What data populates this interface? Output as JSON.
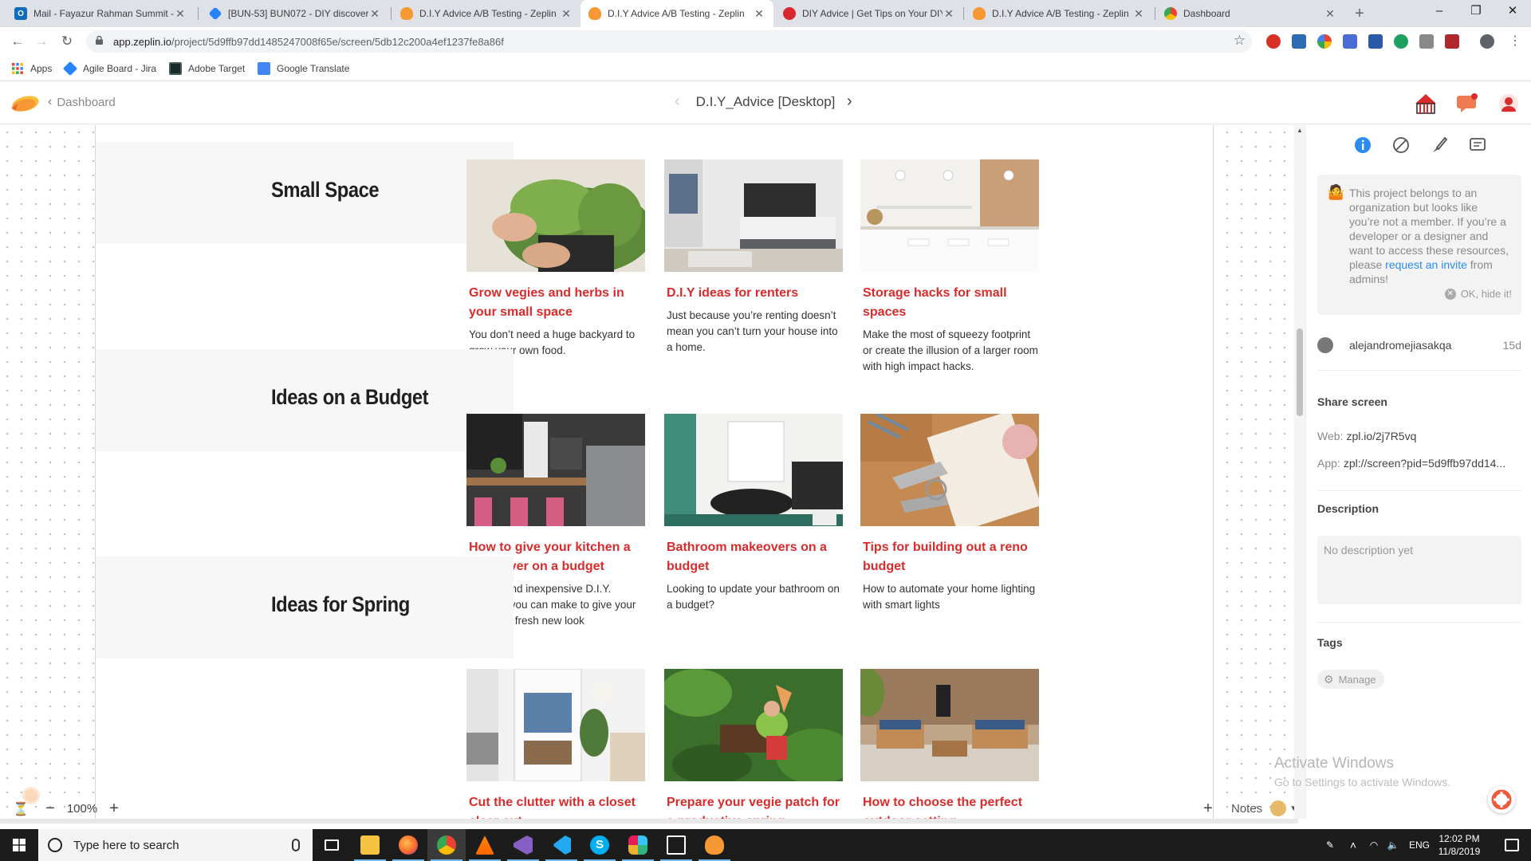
{
  "browser": {
    "tabs": [
      {
        "title": "Mail - Fayazur Rahman Summit -",
        "icon": "outlook-icon",
        "color": "#0f6cbd"
      },
      {
        "title": "[BUN-53] BUN072 - DIY discover",
        "icon": "jira-icon",
        "color": "#2684ff"
      },
      {
        "title": "D.I.Y Advice A/B Testing - Zeplin",
        "icon": "zeplin-icon",
        "color": "#f69833"
      },
      {
        "title": "D.I.Y Advice A/B Testing - Zeplin",
        "icon": "zeplin-icon",
        "color": "#f69833"
      },
      {
        "title": "DIY Advice | Get Tips on Your DIY",
        "icon": "bunnings-icon",
        "color": "#d9272e"
      },
      {
        "title": "D.I.Y Advice A/B Testing - Zeplin",
        "icon": "zeplin-icon",
        "color": "#f69833"
      },
      {
        "title": "Dashboard",
        "icon": "chrome-icon",
        "color": "#4caf50"
      }
    ],
    "active_tab": 3,
    "url_host": "app.zeplin.io",
    "url_path": "/project/5d9ffb97dd1485247008f65e/screen/5db12c200a4ef1237fe8a86f",
    "bookmarks": [
      {
        "label": "Apps",
        "icon": "apps-grid-icon"
      },
      {
        "label": "Agile Board - Jira",
        "icon": "jira-icon"
      },
      {
        "label": "Adobe Target",
        "icon": "adobe-target-icon"
      },
      {
        "label": "Google Translate",
        "icon": "google-translate-icon"
      }
    ]
  },
  "zeplin": {
    "back_label": "Dashboard",
    "screen_title": "D.I.Y_Advice [Desktop]"
  },
  "design": {
    "sections": [
      {
        "title": "Small Space",
        "cards": [
          {
            "title": "Grow vegies and herbs in your small space",
            "desc": "You don’t need a huge backyard to grow your own food.",
            "image": "herbs-photo"
          },
          {
            "title": "D.I.Y ideas for renters",
            "desc": "Just because you’re renting doesn’t mean you can’t turn your house into a home.",
            "image": "bedroom-photo"
          },
          {
            "title": "Storage hacks for small spaces",
            "desc": "Make the most of squeezy footprint or create the illusion of a larger room with high impact hacks.",
            "image": "kitchen-shelves-photo"
          }
        ]
      },
      {
        "title": "Ideas on a Budget",
        "cards": [
          {
            "title": "How to give your kitchen a makeover on a budget",
            "desc": "Simple and inexpensive D.I.Y. updates you can make to give your kitchen a fresh new look",
            "image": "kitchen-photo"
          },
          {
            "title": "Bathroom makeovers on a budget",
            "desc": "Looking to update your bathroom on a budget?",
            "image": "bathroom-photo"
          },
          {
            "title": "Tips for building out a reno budget",
            "desc": "How to automate your home lighting with smart lights",
            "image": "keys-photo"
          }
        ]
      },
      {
        "title": "Ideas for Spring",
        "cards": [
          {
            "title": "Cut the clutter with a closet clear out",
            "desc": "",
            "image": "closet-photo"
          },
          {
            "title": "Prepare your vegie patch for a productive spring",
            "desc": "",
            "image": "garden-photo"
          },
          {
            "title": "How to choose the perfect outdoor setting",
            "desc": "",
            "image": "patio-photo"
          }
        ]
      }
    ]
  },
  "canvas": {
    "zoom": "100%",
    "zoom_out": "−",
    "zoom_in": "+",
    "add": "+",
    "notes_label": "Notes"
  },
  "sidebar": {
    "notice_text_1": "This project belongs to an organization but looks like you’re not a member. If you’re a developer or a designer and want to access these resources, please ",
    "notice_link": "request an invite",
    "notice_text_2": " from admins!",
    "hide_label": "OK, hide it!",
    "owner_name": "alejandromejiasakqa",
    "owner_age": "15d",
    "share_heading": "Share screen",
    "web_label": "Web:",
    "web_value": "zpl.io/2j7R5vq",
    "app_label": "App:",
    "app_value": "zpl://screen?pid=5d9ffb97dd14...",
    "description_heading": "Description",
    "description_placeholder": "No description yet",
    "tags_heading": "Tags",
    "manage_label": "Manage",
    "watermark_title": "Activate Windows",
    "watermark_sub": "Go to Settings to activate Windows."
  },
  "taskbar": {
    "search_placeholder": "Type here to search",
    "language": "ENG",
    "time": "12:02 PM",
    "date": "11/8/2019",
    "apps": [
      "task-view-icon",
      "file-explorer-icon",
      "firefox-icon",
      "chrome-icon",
      "vlc-icon",
      "visual-studio-icon",
      "vscode-icon",
      "skype-icon",
      "slack-icon",
      "photos-icon",
      "zeplin-icon"
    ]
  }
}
